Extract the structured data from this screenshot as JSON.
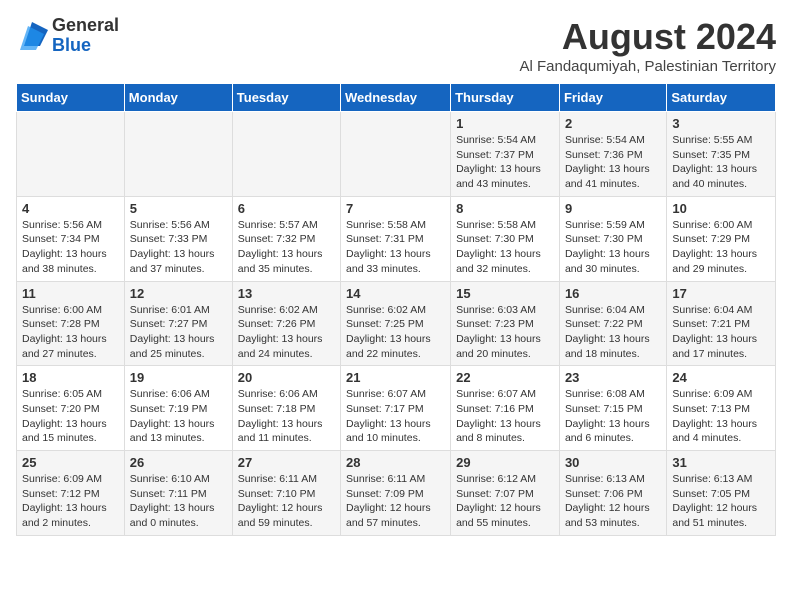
{
  "logo": {
    "general": "General",
    "blue": "Blue"
  },
  "title": "August 2024",
  "location": "Al Fandaqumiyah, Palestinian Territory",
  "days_header": [
    "Sunday",
    "Monday",
    "Tuesday",
    "Wednesday",
    "Thursday",
    "Friday",
    "Saturday"
  ],
  "weeks": [
    [
      {
        "day": "",
        "info": ""
      },
      {
        "day": "",
        "info": ""
      },
      {
        "day": "",
        "info": ""
      },
      {
        "day": "",
        "info": ""
      },
      {
        "day": "1",
        "info": "Sunrise: 5:54 AM\nSunset: 7:37 PM\nDaylight: 13 hours\nand 43 minutes."
      },
      {
        "day": "2",
        "info": "Sunrise: 5:54 AM\nSunset: 7:36 PM\nDaylight: 13 hours\nand 41 minutes."
      },
      {
        "day": "3",
        "info": "Sunrise: 5:55 AM\nSunset: 7:35 PM\nDaylight: 13 hours\nand 40 minutes."
      }
    ],
    [
      {
        "day": "4",
        "info": "Sunrise: 5:56 AM\nSunset: 7:34 PM\nDaylight: 13 hours\nand 38 minutes."
      },
      {
        "day": "5",
        "info": "Sunrise: 5:56 AM\nSunset: 7:33 PM\nDaylight: 13 hours\nand 37 minutes."
      },
      {
        "day": "6",
        "info": "Sunrise: 5:57 AM\nSunset: 7:32 PM\nDaylight: 13 hours\nand 35 minutes."
      },
      {
        "day": "7",
        "info": "Sunrise: 5:58 AM\nSunset: 7:31 PM\nDaylight: 13 hours\nand 33 minutes."
      },
      {
        "day": "8",
        "info": "Sunrise: 5:58 AM\nSunset: 7:30 PM\nDaylight: 13 hours\nand 32 minutes."
      },
      {
        "day": "9",
        "info": "Sunrise: 5:59 AM\nSunset: 7:30 PM\nDaylight: 13 hours\nand 30 minutes."
      },
      {
        "day": "10",
        "info": "Sunrise: 6:00 AM\nSunset: 7:29 PM\nDaylight: 13 hours\nand 29 minutes."
      }
    ],
    [
      {
        "day": "11",
        "info": "Sunrise: 6:00 AM\nSunset: 7:28 PM\nDaylight: 13 hours\nand 27 minutes."
      },
      {
        "day": "12",
        "info": "Sunrise: 6:01 AM\nSunset: 7:27 PM\nDaylight: 13 hours\nand 25 minutes."
      },
      {
        "day": "13",
        "info": "Sunrise: 6:02 AM\nSunset: 7:26 PM\nDaylight: 13 hours\nand 24 minutes."
      },
      {
        "day": "14",
        "info": "Sunrise: 6:02 AM\nSunset: 7:25 PM\nDaylight: 13 hours\nand 22 minutes."
      },
      {
        "day": "15",
        "info": "Sunrise: 6:03 AM\nSunset: 7:23 PM\nDaylight: 13 hours\nand 20 minutes."
      },
      {
        "day": "16",
        "info": "Sunrise: 6:04 AM\nSunset: 7:22 PM\nDaylight: 13 hours\nand 18 minutes."
      },
      {
        "day": "17",
        "info": "Sunrise: 6:04 AM\nSunset: 7:21 PM\nDaylight: 13 hours\nand 17 minutes."
      }
    ],
    [
      {
        "day": "18",
        "info": "Sunrise: 6:05 AM\nSunset: 7:20 PM\nDaylight: 13 hours\nand 15 minutes."
      },
      {
        "day": "19",
        "info": "Sunrise: 6:06 AM\nSunset: 7:19 PM\nDaylight: 13 hours\nand 13 minutes."
      },
      {
        "day": "20",
        "info": "Sunrise: 6:06 AM\nSunset: 7:18 PM\nDaylight: 13 hours\nand 11 minutes."
      },
      {
        "day": "21",
        "info": "Sunrise: 6:07 AM\nSunset: 7:17 PM\nDaylight: 13 hours\nand 10 minutes."
      },
      {
        "day": "22",
        "info": "Sunrise: 6:07 AM\nSunset: 7:16 PM\nDaylight: 13 hours\nand 8 minutes."
      },
      {
        "day": "23",
        "info": "Sunrise: 6:08 AM\nSunset: 7:15 PM\nDaylight: 13 hours\nand 6 minutes."
      },
      {
        "day": "24",
        "info": "Sunrise: 6:09 AM\nSunset: 7:13 PM\nDaylight: 13 hours\nand 4 minutes."
      }
    ],
    [
      {
        "day": "25",
        "info": "Sunrise: 6:09 AM\nSunset: 7:12 PM\nDaylight: 13 hours\nand 2 minutes."
      },
      {
        "day": "26",
        "info": "Sunrise: 6:10 AM\nSunset: 7:11 PM\nDaylight: 13 hours\nand 0 minutes."
      },
      {
        "day": "27",
        "info": "Sunrise: 6:11 AM\nSunset: 7:10 PM\nDaylight: 12 hours\nand 59 minutes."
      },
      {
        "day": "28",
        "info": "Sunrise: 6:11 AM\nSunset: 7:09 PM\nDaylight: 12 hours\nand 57 minutes."
      },
      {
        "day": "29",
        "info": "Sunrise: 6:12 AM\nSunset: 7:07 PM\nDaylight: 12 hours\nand 55 minutes."
      },
      {
        "day": "30",
        "info": "Sunrise: 6:13 AM\nSunset: 7:06 PM\nDaylight: 12 hours\nand 53 minutes."
      },
      {
        "day": "31",
        "info": "Sunrise: 6:13 AM\nSunset: 7:05 PM\nDaylight: 12 hours\nand 51 minutes."
      }
    ]
  ]
}
